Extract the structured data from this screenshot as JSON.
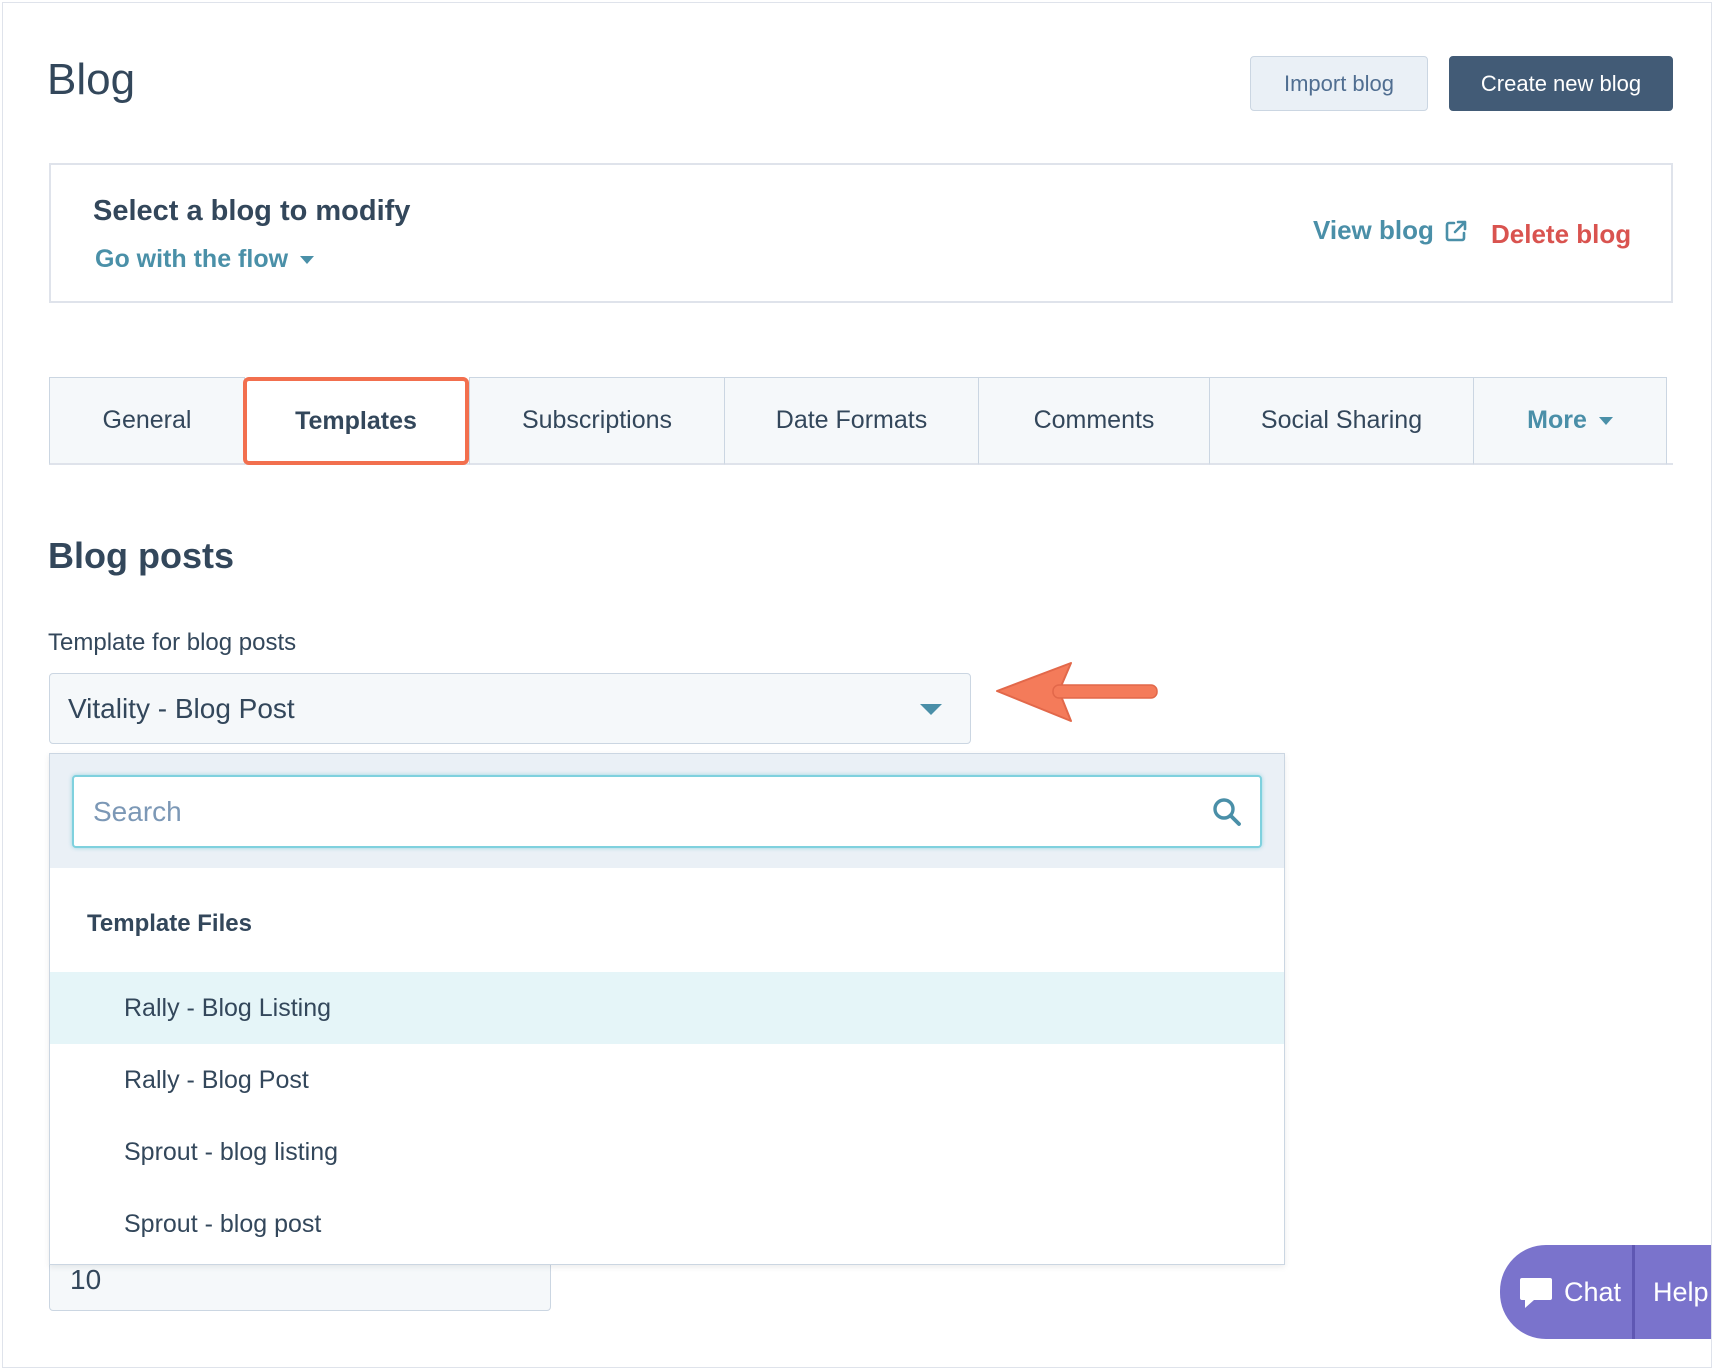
{
  "header": {
    "title": "Blog",
    "import_label": "Import blog",
    "create_label": "Create new blog"
  },
  "blog_selector": {
    "heading": "Select a blog to modify",
    "selected_blog": "Go with the flow",
    "view_label": "View blog",
    "delete_label": "Delete blog"
  },
  "tabs": [
    {
      "label": "General"
    },
    {
      "label": "Templates",
      "active": true
    },
    {
      "label": "Subscriptions"
    },
    {
      "label": "Date Formats"
    },
    {
      "label": "Comments"
    },
    {
      "label": "Social Sharing"
    },
    {
      "label": "More"
    }
  ],
  "section": {
    "heading": "Blog posts",
    "template_label": "Template for blog posts",
    "template_value": "Vitality - Blog Post"
  },
  "dropdown": {
    "search_placeholder": "Search",
    "group_label": "Template Files",
    "options": [
      {
        "label": "Rally - Blog Listing",
        "highlighted": true
      },
      {
        "label": "Rally - Blog Post"
      },
      {
        "label": "Sprout - blog listing"
      },
      {
        "label": "Sprout - blog post"
      }
    ]
  },
  "posts_per_page_value": "10",
  "chat_widget": {
    "chat_label": "Chat",
    "help_label": "Help"
  },
  "colors": {
    "accent": "#4a8fa8",
    "primary_button": "#425b76",
    "delete": "#d9534f",
    "highlight_border": "#f26f4e",
    "chat": "#7a73cc"
  }
}
